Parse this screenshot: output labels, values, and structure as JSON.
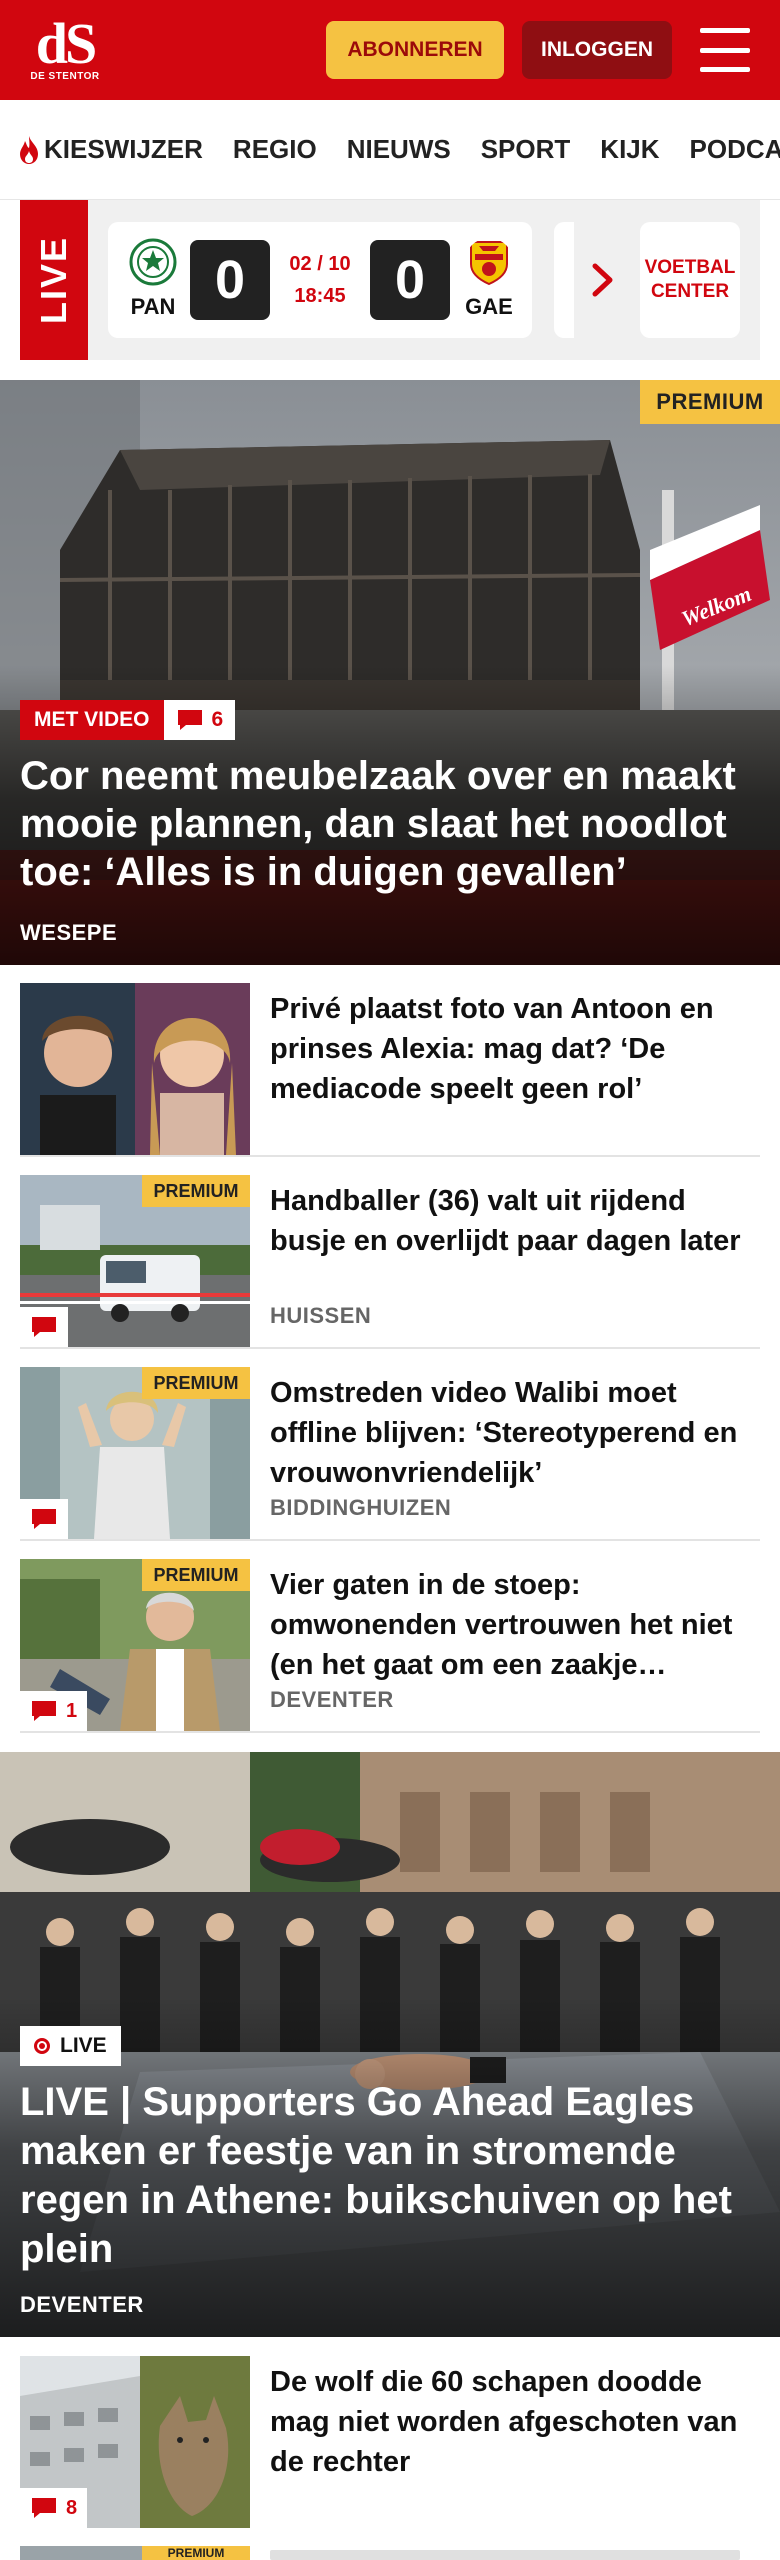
{
  "header": {
    "logo_mark": "dS",
    "logo_sub": "DE STENTOR",
    "subscribe_label": "ABONNEREN",
    "login_label": "INLOGGEN"
  },
  "nav": {
    "items": [
      {
        "label": "KIESWIJZER",
        "icon": "flame-icon"
      },
      {
        "label": "REGIO"
      },
      {
        "label": "NIEUWS"
      },
      {
        "label": "SPORT"
      },
      {
        "label": "KIJK"
      },
      {
        "label": "PODCAS"
      }
    ]
  },
  "live_scores": {
    "label": "LIVE",
    "match": {
      "home_code": "PAN",
      "away_code": "GAE",
      "home_score": "0",
      "away_score": "0",
      "date": "02 / 10",
      "time": "18:45"
    },
    "more_label": "VOETBAL CENTER",
    "colors": {
      "accent": "#d1060f"
    }
  },
  "hero": {
    "premium": "PREMIUM",
    "tag": "MET VIDEO",
    "comments": "6",
    "title": "Cor neemt meubelzaak over en maakt mooie plannen, dan slaat het noodlot toe: ‘Alles is in duigen gevallen’",
    "location": "WESEPE",
    "image_sign": "Welkom"
  },
  "articles": [
    {
      "title": "Privé plaatst foto van Antoon en prinses Alexia: mag dat? ‘De mediacode speelt geen rol’",
      "location": "",
      "premium": "",
      "comments": ""
    },
    {
      "title": "Handballer (36) valt uit rijdend busje en overlijdt paar dagen later",
      "location": "HUISSEN",
      "premium": "PREMIUM",
      "comments": ""
    },
    {
      "title": "Omstreden video Walibi moet offline blijven: ‘Stereotyperend en vrouwonvriendelijk’",
      "location": "BIDDINGHUIZEN",
      "premium": "PREMIUM",
      "comments": ""
    },
    {
      "title": "Vier gaten in de stoep: omwonenden vertrouwen het niet (en het gaat om een zaakje…",
      "location": "DEVENTER",
      "premium": "PREMIUM",
      "comments": "1"
    }
  ],
  "live_hero": {
    "badge": "LIVE",
    "title": "LIVE | Supporters Go Ahead Eagles maken er feestje van in stromende regen in Athene: buikschuiven op het plein",
    "location": "DEVENTER"
  },
  "bottom_article": {
    "title": "De wolf die 60 schapen doodde mag niet worden afgeschoten van de rechter",
    "comments": "8"
  },
  "teaser": {
    "premium": "PREMIUM"
  }
}
